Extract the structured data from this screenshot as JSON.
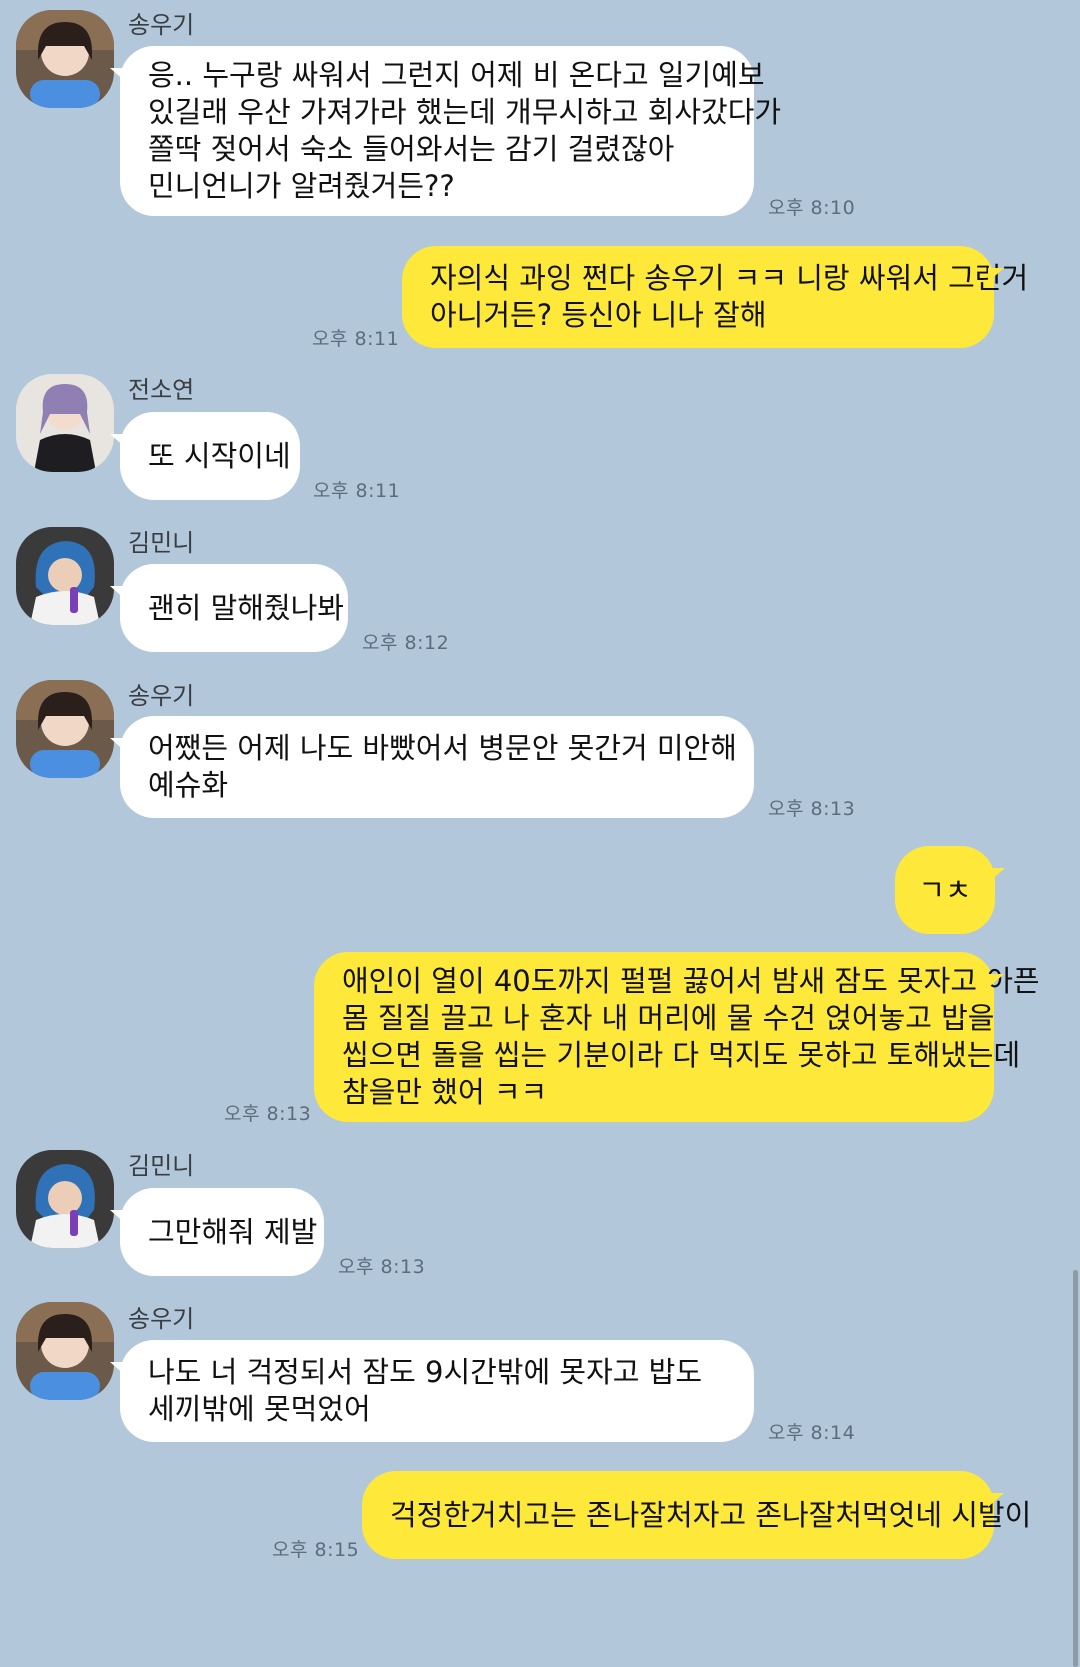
{
  "colors": {
    "background": "#b2c7da",
    "incoming_bubble": "#ffffff",
    "outgoing_bubble": "#fee93a",
    "timestamp": "#5d6c7b"
  },
  "messages": [
    {
      "sender": "송우기",
      "avatar": "profile-photo-icon",
      "lines": [
        "응.. 누구랑 싸워서 그런지 어제 비 온다고 일기예보",
        "있길래 우산 가져가라 했는데 개무시하고 회사갔다가",
        "쫄딱 젖어서 숙소 들어와서는 감기 걸렸잖아",
        "민니언니가 알려줬거든??"
      ],
      "time": "오후 8:10"
    },
    {
      "sender": "me",
      "lines": [
        "자의식 과잉 쩐다 송우기 ㅋㅋ 니랑 싸워서 그런거",
        "아니거든? 등신아 니나 잘해"
      ],
      "time": "오후 8:11"
    },
    {
      "sender": "전소연",
      "avatar": "profile-photo-icon",
      "lines": [
        "또 시작이네"
      ],
      "time": "오후 8:11"
    },
    {
      "sender": "김민니",
      "avatar": "profile-photo-icon",
      "lines": [
        "괜히 말해줬나봐"
      ],
      "time": "오후 8:12"
    },
    {
      "sender": "송우기",
      "avatar": "profile-photo-icon",
      "lines": [
        "어쨌든 어제 나도 바빴어서 병문안 못간거 미안해",
        "예슈화"
      ],
      "time": "오후 8:13"
    },
    {
      "sender": "me",
      "lines": [
        "ㄱㅊ"
      ],
      "time": ""
    },
    {
      "sender": "me",
      "lines": [
        "애인이 열이 40도까지 펄펄 끓어서 밤새 잠도 못자고 아픈",
        "몸 질질 끌고 나 혼자 내 머리에 물 수건 얹어놓고 밥을",
        "씹으면 돌을 씹는 기분이라 다 먹지도 못하고 토해냈는데",
        "참을만 했어 ㅋㅋ"
      ],
      "time": "오후 8:13"
    },
    {
      "sender": "김민니",
      "avatar": "profile-photo-icon",
      "lines": [
        "그만해줘 제발"
      ],
      "time": "오후 8:13"
    },
    {
      "sender": "송우기",
      "avatar": "profile-photo-icon",
      "lines": [
        "나도 너 걱정되서 잠도 9시간밖에 못자고 밥도",
        "세끼밖에 못먹었어"
      ],
      "time": "오후 8:14"
    },
    {
      "sender": "me",
      "lines": [
        "걱정한거치고는 존나잘처자고 존나잘처먹엇네 시발이"
      ],
      "time": "오후 8:15"
    }
  ]
}
